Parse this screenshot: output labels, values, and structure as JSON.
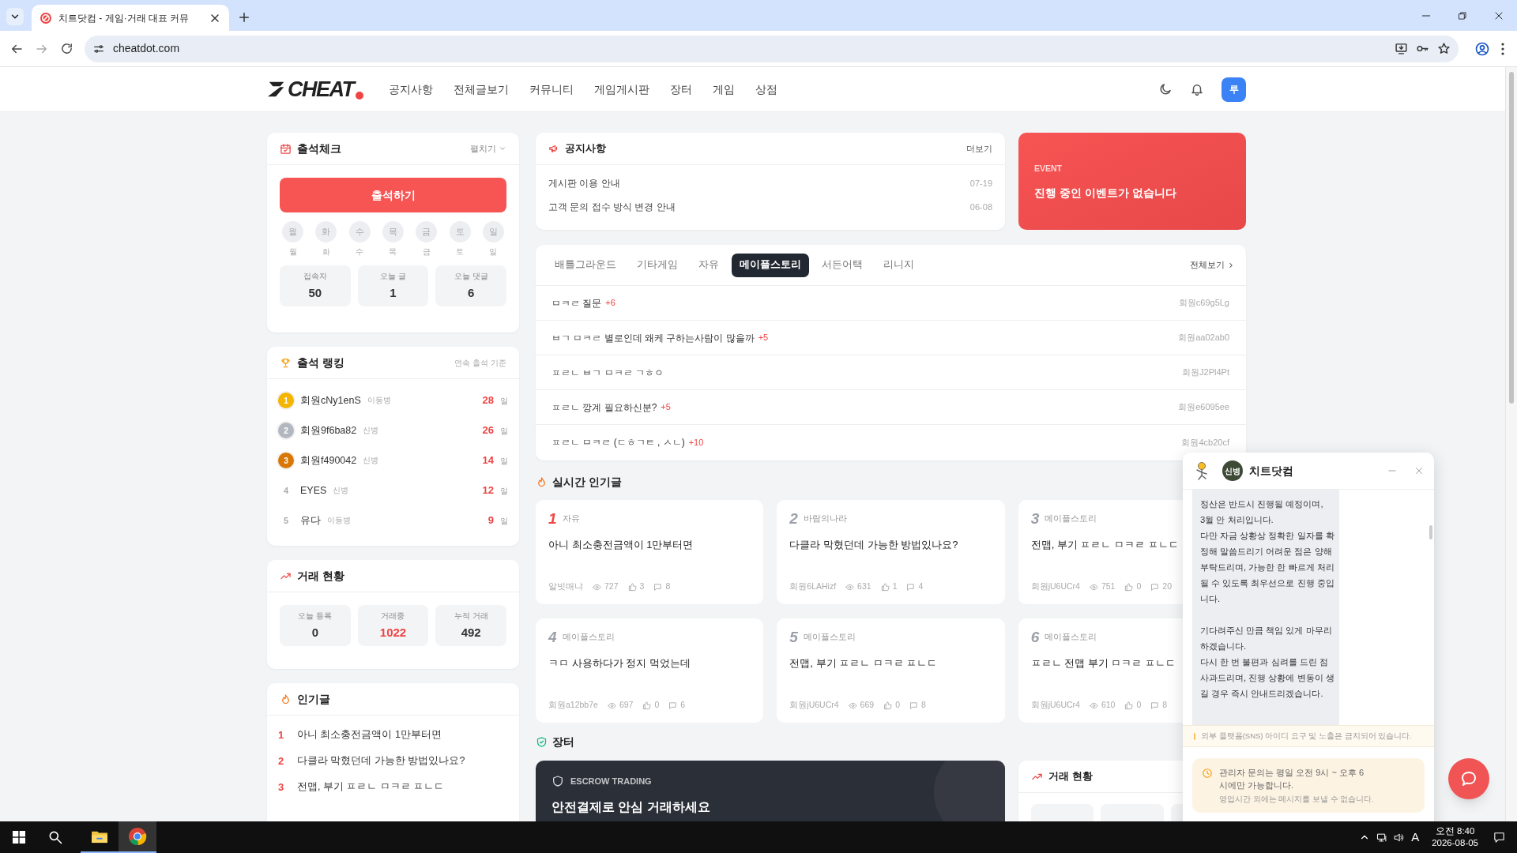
{
  "browser": {
    "tab_title": "치트닷컴 - 게임·거래 대표 커뮤",
    "url": "cheatdot.com"
  },
  "nav": {
    "logo": "CHEAT",
    "items": [
      "공지사항",
      "전체글보기",
      "커뮤니티",
      "게임게시판",
      "장터",
      "게임",
      "상점"
    ],
    "avatar": "루"
  },
  "attendance": {
    "title": "출석체크",
    "toggle": "펼치기",
    "button": "출석하기",
    "days": [
      {
        "circle": "월",
        "label": "월",
        "checked": false
      },
      {
        "circle": "화",
        "label": "화",
        "checked": false
      },
      {
        "circle": "수",
        "label": "수",
        "checked": false
      },
      {
        "circle": "목",
        "label": "목",
        "checked": false
      },
      {
        "circle": "금",
        "label": "금",
        "checked": false
      },
      {
        "circle": "토",
        "label": "토",
        "checked": false
      },
      {
        "circle": "일",
        "label": "일",
        "checked": false
      }
    ],
    "stats": [
      {
        "label": "접속자",
        "value": "50"
      },
      {
        "label": "오늘 글",
        "value": "1"
      },
      {
        "label": "오늘 댓글",
        "value": "6"
      }
    ]
  },
  "ranking": {
    "title": "출석 랭킹",
    "note": "연속 출석 기준",
    "rows": [
      {
        "rank": "1",
        "kind": "medal",
        "color": "#f5b400",
        "name": "회원cNy1enS",
        "grade": "이등병",
        "days": "28",
        "unit": "일"
      },
      {
        "rank": "2",
        "kind": "medal",
        "color": "#b3b8c0",
        "name": "회원9f6ba82",
        "grade": "신병",
        "days": "26",
        "unit": "일"
      },
      {
        "rank": "3",
        "kind": "medal",
        "color": "#d97706",
        "name": "회원f490042",
        "grade": "신병",
        "days": "14",
        "unit": "일"
      },
      {
        "rank": "4",
        "kind": "plain",
        "name": "EYES",
        "grade": "신병",
        "days": "12",
        "unit": "일"
      },
      {
        "rank": "5",
        "kind": "plain",
        "name": "유다",
        "grade": "이등병",
        "days": "9",
        "unit": "일"
      }
    ]
  },
  "trade_side": {
    "title": "거래 현황",
    "stats": [
      {
        "label": "오늘 등록",
        "value": "0",
        "highlight": false
      },
      {
        "label": "거래중",
        "value": "1022",
        "highlight": true
      },
      {
        "label": "누적 거래",
        "value": "492",
        "highlight": false
      }
    ]
  },
  "popular": {
    "title": "인기글",
    "items": [
      {
        "rank": "1",
        "title": "아니 최소충전금액이 1만부터면"
      },
      {
        "rank": "2",
        "title": "다클라 막혔던데 가능한 방법있나요?"
      },
      {
        "rank": "3",
        "title": "전맵, 부기 ㅍㄹㄴ ㅁㅋㄹ ㅍㄴㄷ"
      }
    ]
  },
  "notice": {
    "title": "공지사항",
    "more": "더보기",
    "items": [
      {
        "title": "게시판 이용 안내",
        "date": "07-19"
      },
      {
        "title": "고객 문의 접수 방식 변경 안내",
        "date": "06-08"
      }
    ]
  },
  "event": {
    "tag": "EVENT",
    "text": "진행 중인 이벤트가 없습니다"
  },
  "board": {
    "tabs": [
      {
        "label": "배틀그라운드",
        "selected": false
      },
      {
        "label": "기타게임",
        "selected": false
      },
      {
        "label": "자유",
        "selected": false
      },
      {
        "label": "메이플스토리",
        "selected": true
      },
      {
        "label": "서든어택",
        "selected": false
      },
      {
        "label": "리니지",
        "selected": false
      }
    ],
    "more": "전체보기",
    "posts": [
      {
        "title": "ㅁㅋㄹ 질문",
        "comments": "+6",
        "author": "회원c69g5Lg"
      },
      {
        "title": "ㅂㄱ ㅁㅋㄹ 별로인데 왜케 구하는사람이 많을까",
        "comments": "+5",
        "author": "회원aa02ab0"
      },
      {
        "title": "ㅍㄹㄴ ㅂㄱ ㅁㅋㄹ ㄱㅎㅇ",
        "author": "회원J2Pl4Pt"
      },
      {
        "title": "ㅍㄹㄴ 깡계 필요하신분?",
        "comments": "+5",
        "author": "회원e6095ee"
      },
      {
        "title": "ㅍㄹㄴ ㅁㅋㄹ (ㄷㅎㄱㅌ , ㅅㄴ)",
        "comments": "+10",
        "author": "회원4cb20cf"
      }
    ]
  },
  "realtime": {
    "title": "실시간 인기글",
    "cards": [
      {
        "rank": "1",
        "top": true,
        "category": "자유",
        "title": "아니 최소충전금액이 1만부터면",
        "author": "알빗매냐",
        "views": "727",
        "likes": "3",
        "comments": "8"
      },
      {
        "rank": "2",
        "top": false,
        "category": "바람의나라",
        "title": "다클라 막혔던데 가능한 방법있나요?",
        "author": "회원6LAHizf",
        "views": "631",
        "likes": "1",
        "comments": "4"
      },
      {
        "rank": "3",
        "top": false,
        "category": "메이플스토리",
        "title": "전맵, 부기 ㅍㄹㄴ ㅁㅋㄹ ㅍㄴㄷ",
        "author": "회원jU6UCr4",
        "views": "751",
        "likes": "0",
        "comments": "20"
      },
      {
        "rank": "4",
        "top": false,
        "category": "메이플스토리",
        "title": "ㅋㅁ 사용하다가 정지 먹었는데",
        "author": "회원a12bb7e",
        "views": "697",
        "likes": "0",
        "comments": "6"
      },
      {
        "rank": "5",
        "top": false,
        "category": "메이플스토리",
        "title": "전맵, 부기 ㅍㄹㄴ ㅁㅋㄹ ㅍㄴㄷ",
        "author": "회원jU6UCr4",
        "views": "669",
        "likes": "0",
        "comments": "8"
      },
      {
        "rank": "6",
        "top": false,
        "category": "메이플스토리",
        "title": "ㅍㄹㄴ 전맵 부기 ㅁㅋㄹ ㅍㄴㄷ",
        "author": "회원jU6UCr4",
        "views": "610",
        "likes": "0",
        "comments": "8"
      }
    ]
  },
  "market": {
    "title": "장터",
    "escrow_tag": "ESCROW TRADING",
    "escrow_text": "안전결제로 안심 거래하세요",
    "trade_title": "거래 현황"
  },
  "chat": {
    "badge": "신병",
    "title": "치트닷컴",
    "paragraphs": [
      [
        "정산은 반드시 진행될 예정이며,",
        "3월 안 처리입니다.",
        "다만 자금 상황상 정확한 일자를 확정해 말씀드리기 어려운 점은 양해 부탁드리며, 가능한 한 빠르게 처리될 수 있도록 최우선으로 진행 중입니다."
      ],
      [
        "기다려주신 만큼 책임 있게 마무리하겠습니다.",
        "다시 한 번 불편과 심려를 드린 점 사과드리며, 진행 상황에 변동이 생길 경우 즉시 안내드리겠습니다."
      ]
    ],
    "warning": "외부 플랫폼(SNS) 아이디 요구 및 노출은 금지되어 있습니다.",
    "hours": "관리자 문의는 평일 오전 9시 ~ 오후 6시에만 가능합니다.",
    "hours_note": "영업시간 외에는 메시지를 보낼 수 없습니다."
  },
  "taskbar": {
    "ime": "A",
    "time": "오전 8:40",
    "date": "2026-08-05"
  }
}
